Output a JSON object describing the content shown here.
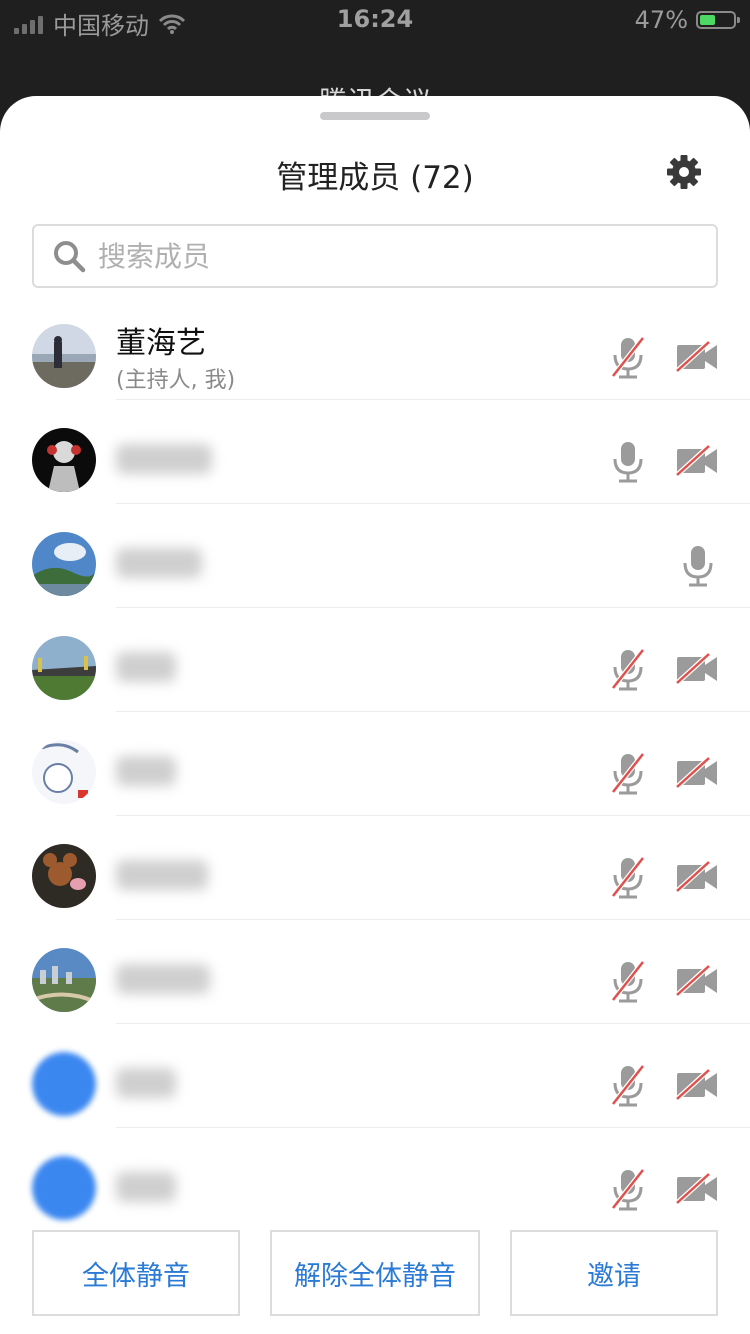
{
  "status_bar": {
    "carrier": "中国移动",
    "time": "16:24",
    "battery": "47%",
    "battery_level": 0.47
  },
  "background_title": "腾讯会议",
  "sheet": {
    "title": "管理成员 (72)"
  },
  "search": {
    "placeholder": "搜索成员"
  },
  "members": [
    {
      "name": "董海艺",
      "subtitle": "(主持人, 我)",
      "mic": "muted",
      "camera": "off",
      "avatar": "photo-landscape-person"
    },
    {
      "name": "",
      "mic": "on",
      "camera": "off",
      "avatar": "photo-dark-portrait"
    },
    {
      "name": "",
      "mic": "on",
      "camera": "none",
      "avatar": "photo-sky-hills"
    },
    {
      "name": "",
      "mic": "muted",
      "camera": "off",
      "avatar": "photo-stadium"
    },
    {
      "name": "",
      "mic": "muted",
      "camera": "off",
      "avatar": "cartoon-drawing"
    },
    {
      "name": "",
      "mic": "muted",
      "camera": "off",
      "avatar": "cartoon-mouse"
    },
    {
      "name": "",
      "mic": "muted",
      "camera": "off",
      "avatar": "photo-city"
    },
    {
      "name": "",
      "mic": "muted",
      "camera": "off",
      "avatar": "blue-default"
    },
    {
      "name": "",
      "mic": "muted",
      "camera": "off",
      "avatar": "blue-default"
    }
  ],
  "buttons": {
    "mute_all": "全体静音",
    "unmute_all": "解除全体静音",
    "invite": "邀请"
  },
  "colors": {
    "accent": "#2a7ad6",
    "muted_slash": "#e0504c",
    "icon_gray": "#9b9b9b",
    "battery": "#4cd964"
  }
}
